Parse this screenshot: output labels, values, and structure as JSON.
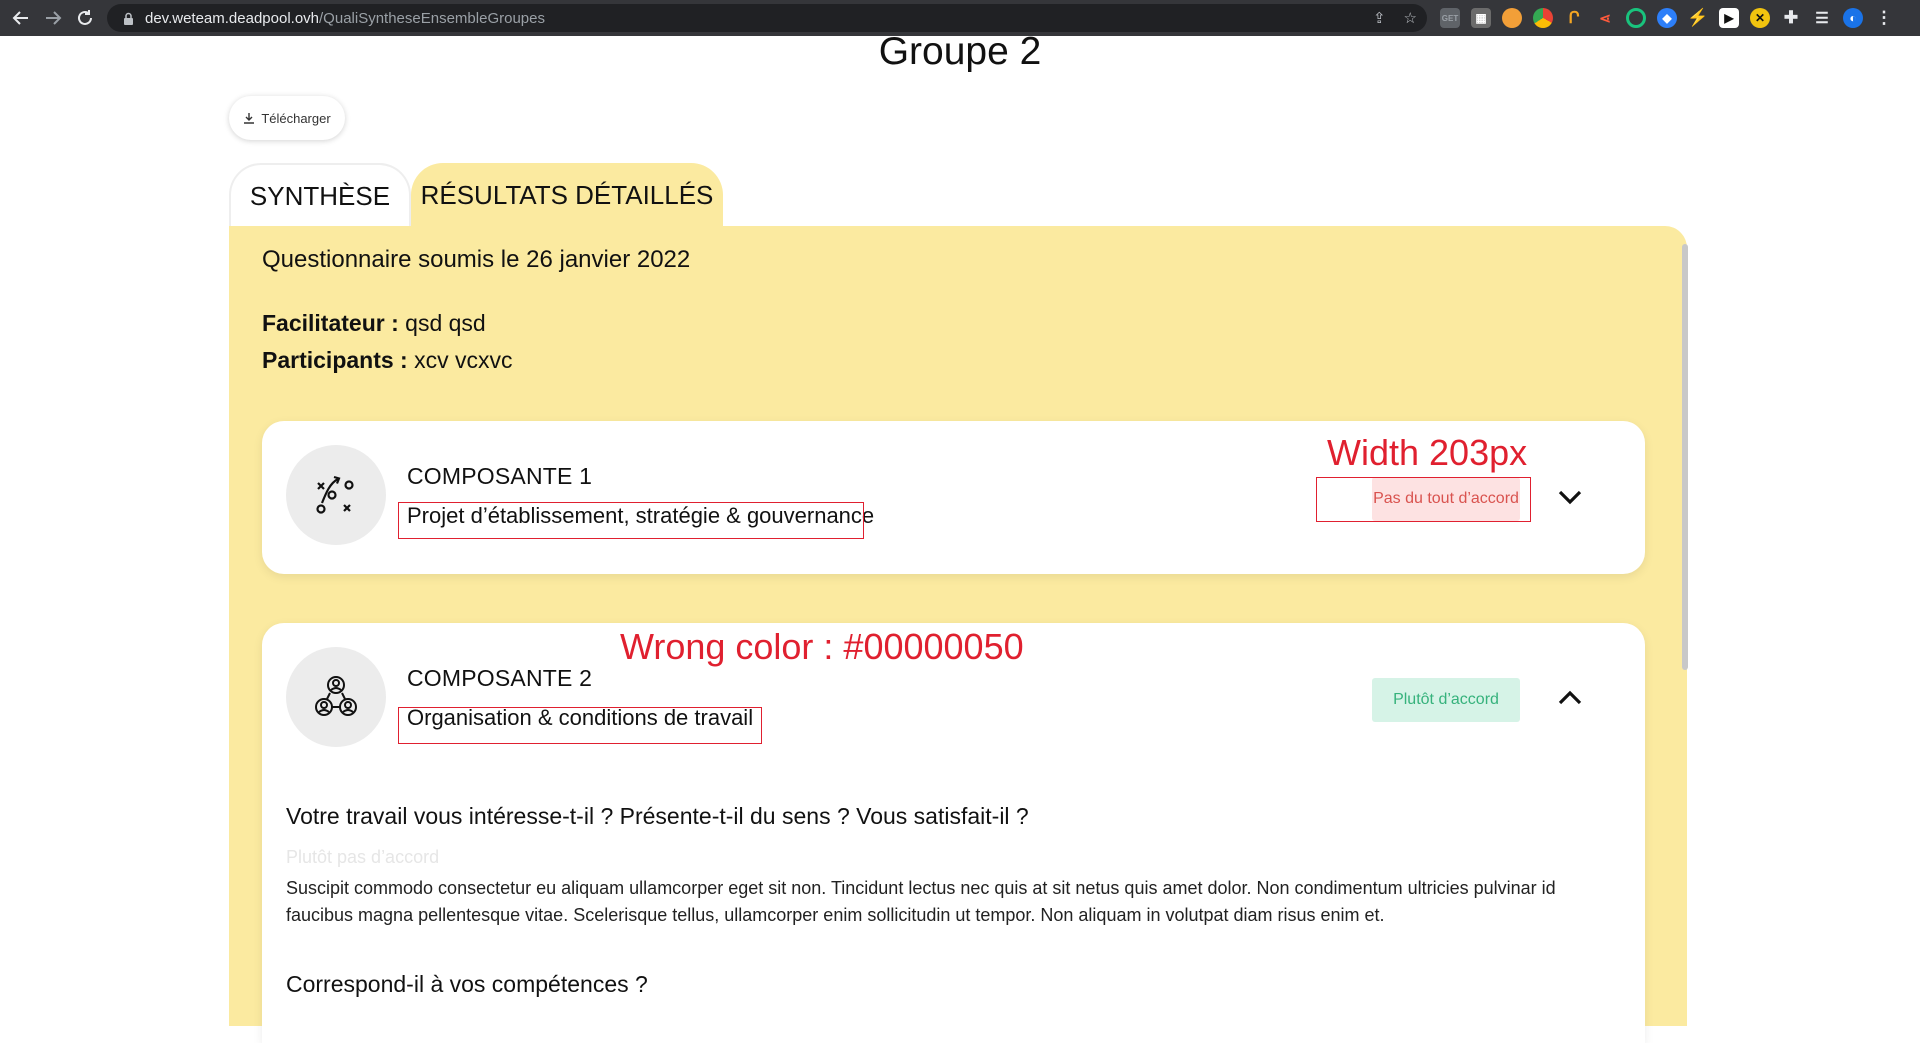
{
  "browser": {
    "url_host": "dev.weteam.deadpool.ovh",
    "url_path": "/QualiSyntheseEnsembleGroupes"
  },
  "page": {
    "title": "Groupe 2",
    "download_label": "Télécharger",
    "tabs": [
      {
        "label": "SYNTHÈSE",
        "active": false
      },
      {
        "label": "RÉSULTATS DÉTAILLÉS",
        "active": true
      }
    ],
    "submitted": "Questionnaire soumis le 26 janvier 2022",
    "facilitator_label": "Facilitateur :",
    "facilitator_value": "qsd qsd",
    "participants_label": "Participants :",
    "participants_value": "xcv vcxvc"
  },
  "components": [
    {
      "title": "COMPOSANTE 1",
      "subtitle": "Projet d’établissement, stratégie & gouvernance",
      "badge": "Pas du tout d’accord",
      "badge_color": "#d9534f",
      "icon": "strategy-icon",
      "expanded": false
    },
    {
      "title": "COMPOSANTE 2",
      "subtitle": "Organisation & conditions de travail",
      "badge": "Plutôt d’accord",
      "badge_color": "#36b27c",
      "icon": "team-icon",
      "expanded": true,
      "questions": [
        {
          "question": "Votre travail vous intéresse-t-il ? Présente-t-il du sens ? Vous satisfait-il ?",
          "answer": "Plutôt pas d’accord",
          "comment": "Suscipit commodo consectetur eu aliquam ullamcorper eget sit non. Tincidunt lectus nec quis at sit netus quis amet dolor. Non condimentum ultricies pulvinar id faucibus magna pellentesque vitae. Scelerisque tellus, ullamcorper enim sollicitudin ut tempor. Non aliquam in volutpat diam risus enim et."
        },
        {
          "question": "Correspond-il à vos compétences ?"
        }
      ]
    }
  ],
  "annotations": {
    "width_note": "Width 203px",
    "color_note": "Wrong color : #00000050",
    "color": "#e0202f"
  }
}
